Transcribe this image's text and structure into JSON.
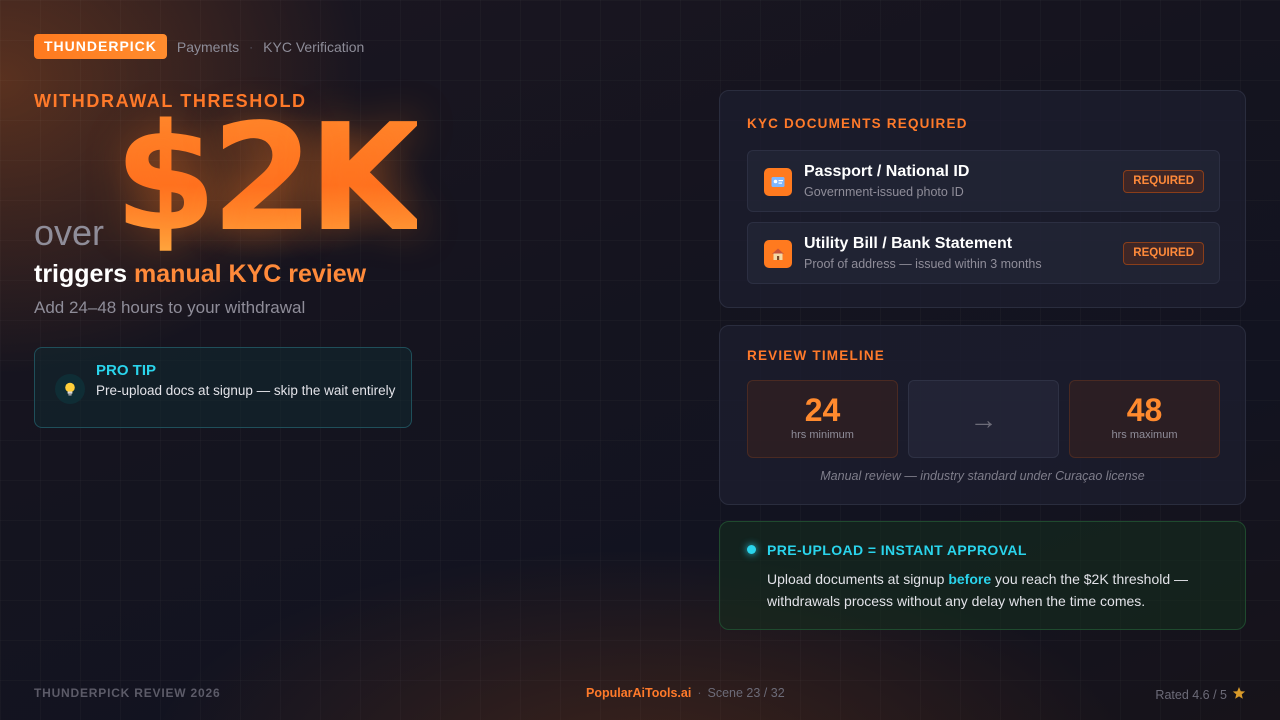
{
  "header": {
    "brand": "THUNDERPICK",
    "crumbs": [
      "Payments",
      "KYC Verification"
    ],
    "separator": "·"
  },
  "hero": {
    "kicker": "WITHDRAWAL THRESHOLD",
    "prefix": "over",
    "amount": "$2K",
    "triggers_prefix": "triggers",
    "triggers_accent": "manual KYC review",
    "subtext": "Add 24–48 hours to your withdrawal"
  },
  "pro_tip": {
    "icon": "lightbulb-icon",
    "title": "PRO TIP",
    "body": "Pre-upload docs at signup — skip the wait entirely"
  },
  "kyc_documents": {
    "title": "KYC DOCUMENTS REQUIRED",
    "items": [
      {
        "icon": "id-card-icon",
        "name": "Passport / National ID",
        "description": "Government-issued photo ID",
        "badge": "REQUIRED"
      },
      {
        "icon": "house-icon",
        "name": "Utility Bill / Bank Statement",
        "description": "Proof of address — issued within 3 months",
        "badge": "REQUIRED"
      }
    ]
  },
  "review_timeline": {
    "title": "REVIEW TIMELINE",
    "min_value": "24",
    "min_label": "hrs minimum",
    "arrow": "→",
    "max_value": "48",
    "max_label": "hrs maximum",
    "note": "Manual review — industry standard under Curaçao license"
  },
  "approval": {
    "title": "PRE-UPLOAD = INSTANT APPROVAL",
    "body_before": "Upload documents at signup ",
    "body_highlight": "before",
    "body_after": " you reach the $2K threshold — withdrawals process without any delay when the time comes."
  },
  "footer": {
    "left": "THUNDERPICK REVIEW 2026",
    "site": "PopularAiTools.ai",
    "separator": "·",
    "scene": "Scene 23 / 32",
    "rating": "Rated 4.6 / 5",
    "rating_icon": "star-icon"
  },
  "colors": {
    "accent_orange": "#ff7a2a",
    "accent_cyan": "#2ad4ec",
    "background": "#15141f"
  }
}
